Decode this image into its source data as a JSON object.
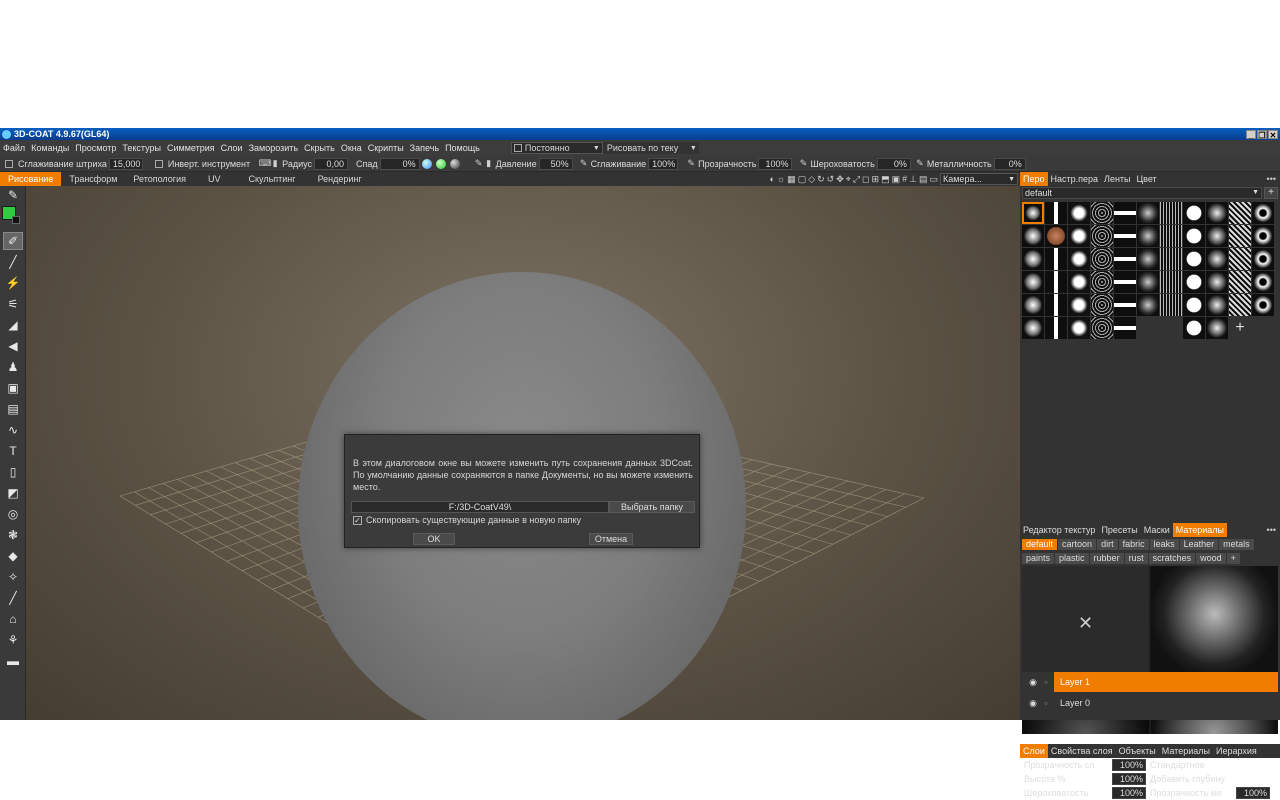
{
  "window": {
    "title": "3D-COAT 4.9.67(GL64)",
    "controls": [
      "_",
      "❐",
      "✕"
    ]
  },
  "menu": {
    "items": [
      "Файл",
      "Команды",
      "Просмотр",
      "Текстуры",
      "Симметрия",
      "Слои",
      "Заморозить",
      "Скрыть",
      "Окна",
      "Скрипты",
      "Запечь",
      "Помощь"
    ],
    "mode_select": "Постоянно",
    "draw_select": "Рисовать по теку"
  },
  "toolbar": {
    "smoothing_stroke_label": "Сглаживание штриха",
    "smoothing_stroke_value": "15,000",
    "invert_label": "Инверт. инструмент",
    "radius_label": "Радиус",
    "radius_value": "0,00",
    "falloff_label": "Спад",
    "falloff_value": "0%",
    "pressure_label": "Давление",
    "pressure_value": "50%",
    "smoothing_label": "Сглаживание",
    "smoothing_value": "100%",
    "transparency_label": "Прозрачность",
    "transparency_value": "100%",
    "roughness_label": "Шероховатость",
    "roughness_value": "0%",
    "metalness_label": "Металличность",
    "metalness_value": "0%"
  },
  "room_tabs": [
    "Рисование",
    "Трансформ",
    "Ретопология",
    "UV",
    "Скульптинг",
    "Рендеринг"
  ],
  "camera_select": "Камера...",
  "dialog": {
    "message": "В этом диалоговом окне вы можете изменить путь сохранения данных 3DCoat. По умолчанию данные сохраняются в папке Документы, но вы можете изменить место.",
    "path": "F:/3D-CoatV49\\",
    "choose_folder": "Выбрать папку",
    "copy_checkbox_mark": "✓",
    "copy_label": "Скопировать существующие данные в новую папку",
    "ok": "OK",
    "cancel": "Отмена"
  },
  "brush_panel": {
    "tabs": [
      "Перо",
      "Настр.пера",
      "Ленты",
      "Цвет"
    ],
    "preset": "default"
  },
  "materials_panel": {
    "tabs": [
      "Редактор текстур",
      "Пресеты",
      "Маски",
      "Материалы"
    ],
    "tags": [
      "default",
      "cartoon",
      "dirt",
      "fabric",
      "leaks",
      "Leather",
      "metals",
      "paints",
      "plastic",
      "rubber",
      "rust",
      "scratches",
      "wood",
      "+"
    ],
    "empty_slot": "✕"
  },
  "layers_panel": {
    "tabs": [
      "Слои",
      "Свойства слоя",
      "Объекты",
      "Материалы",
      "Иерархия"
    ],
    "opacity_label": "Прозрачность сл",
    "opacity_value": "100%",
    "blend_mode": "Стандартное",
    "height_label": "Высота %",
    "height_value": "100%",
    "depth_mode": "Добавить глубину",
    "roughness_label": "Шероховатость",
    "roughness_value": "100%",
    "transparency_label": "Прозрачность ме",
    "transparency_value": "100%",
    "layers": [
      "Layer 1",
      "Layer 0"
    ]
  },
  "colors": {
    "accent": "#f07c00",
    "primary_color": "#2ecc40"
  }
}
